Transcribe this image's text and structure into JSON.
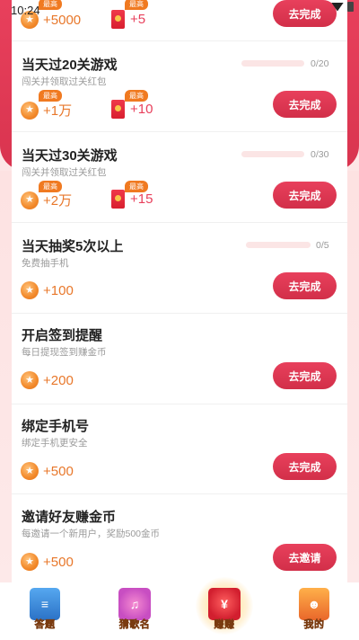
{
  "status_bar": {
    "time": "10:24"
  },
  "tasks": [
    {
      "title": "",
      "subtitle": "",
      "coin_reward": "+5000",
      "coin_tag": "最高",
      "envelope_reward": "+5",
      "envelope_tag": "最高",
      "button": "去完成"
    },
    {
      "title": "当天过20关游戏",
      "subtitle": "闯关并领取过关红包",
      "progress_text": "0/20",
      "progress": 0,
      "coin_reward": "+1万",
      "coin_tag": "最高",
      "envelope_reward": "+10",
      "envelope_tag": "最高",
      "button": "去完成"
    },
    {
      "title": "当天过30关游戏",
      "subtitle": "闯关并领取过关红包",
      "progress_text": "0/30",
      "progress": 0,
      "coin_reward": "+2万",
      "coin_tag": "最高",
      "envelope_reward": "+15",
      "envelope_tag": "最高",
      "button": "去完成"
    },
    {
      "title": "当天抽奖5次以上",
      "subtitle": "免费抽手机",
      "progress_text": "0/5",
      "progress": 0,
      "coin_reward": "+100",
      "button": "去完成"
    },
    {
      "title": "开启签到提醒",
      "subtitle": "每日提现签到赚金币",
      "coin_reward": "+200",
      "button": "去完成"
    },
    {
      "title": "绑定手机号",
      "subtitle": "绑定手机更安全",
      "coin_reward": "+500",
      "button": "去完成"
    },
    {
      "title": "邀请好友赚金币",
      "subtitle": "每邀请一个新用户，奖励500金币",
      "coin_reward": "+500",
      "button": "去邀请"
    }
  ],
  "tab_bar": [
    {
      "label": "答题",
      "icon": "book-icon"
    },
    {
      "label": "猜歌名",
      "icon": "music-note-icon"
    },
    {
      "label": "赚赚",
      "icon": "red-bag-icon",
      "active": true
    },
    {
      "label": "我的",
      "icon": "profile-icon"
    }
  ],
  "colors": {
    "primary": "#e8405c",
    "coin": "#e8772a",
    "tag": "#f07a21",
    "background": "#fde6e6"
  }
}
